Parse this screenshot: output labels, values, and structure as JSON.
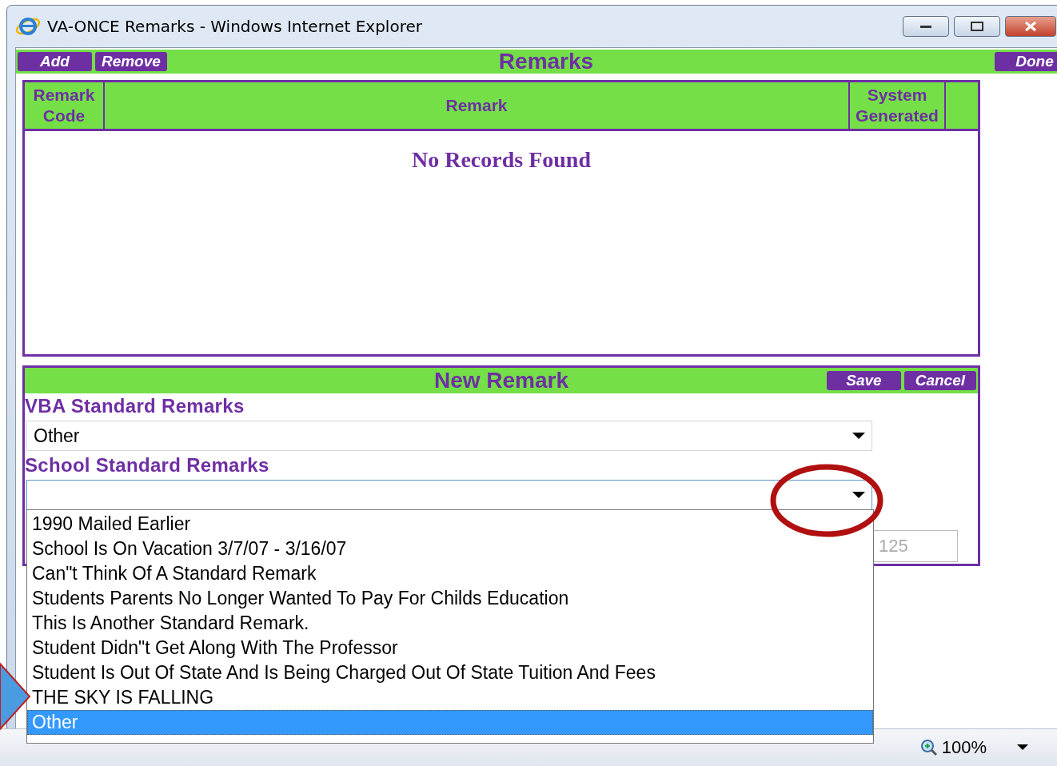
{
  "window": {
    "title": "VA-ONCE Remarks - Windows Internet Explorer"
  },
  "toolbar": {
    "left_buttons": [
      "Add",
      "Remove"
    ],
    "title": "Remarks",
    "right_button": "Done"
  },
  "table": {
    "columns": [
      "Remark Code",
      "Remark",
      "System Generated"
    ],
    "empty_message": "No Records Found"
  },
  "new_remark": {
    "title": "New Remark",
    "buttons": [
      "Save",
      "Cancel"
    ],
    "vba_label": "VBA Standard Remarks",
    "vba_value": "Other",
    "school_label": "School Standard Remarks",
    "school_dropdown": {
      "expanded": true,
      "options": [
        {
          "label": "1990 Mailed Earlier",
          "selected": false
        },
        {
          "label": "School Is On Vacation 3/7/07 - 3/16/07",
          "selected": false
        },
        {
          "label": "Can\"t Think Of A Standard Remark",
          "selected": false
        },
        {
          "label": "Students Parents No Longer Wanted To Pay For Childs Education",
          "selected": false
        },
        {
          "label": "This Is Another Standard Remark.",
          "selected": false
        },
        {
          "label": "Student Didn\"t Get Along With The Professor",
          "selected": false
        },
        {
          "label": "Student Is Out Of State And Is Being Charged Out Of State Tuition And Fees",
          "selected": false
        },
        {
          "label": "THE SKY IS FALLING",
          "selected": false
        },
        {
          "label": "Other",
          "selected": true
        }
      ]
    },
    "counter": {
      "value": "125",
      "disabled": true
    }
  },
  "status_bar": {
    "zoom": "100%"
  }
}
